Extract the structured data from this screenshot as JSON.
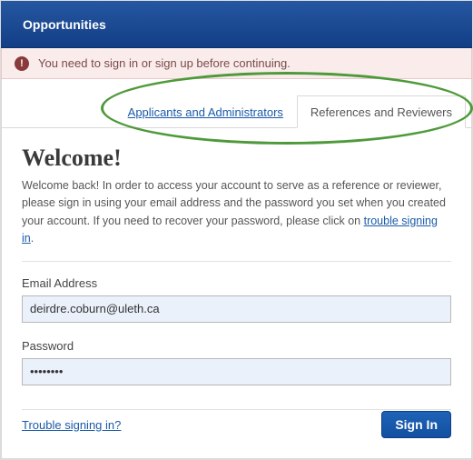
{
  "header": {
    "brand": "Opportunities"
  },
  "alert": {
    "icon": "!",
    "text": "You need to sign in or sign up before continuing."
  },
  "tabs": {
    "applicants": "Applicants and Administrators",
    "reviewers": "References and Reviewers"
  },
  "welcome": {
    "title": "Welcome!",
    "body_a": "Welcome back! In order to access your account to serve as a reference or reviewer, please sign in using your email address and the password you set when you created your account. If you need to recover your password, please click on ",
    "body_link": "trouble signing in",
    "body_b": "."
  },
  "form": {
    "email_label": "Email Address",
    "email_value": "deirdre.coburn@uleth.ca",
    "password_label": "Password",
    "password_value": "••••••••"
  },
  "footer": {
    "trouble": "Trouble signing in?",
    "signin": "Sign In"
  }
}
